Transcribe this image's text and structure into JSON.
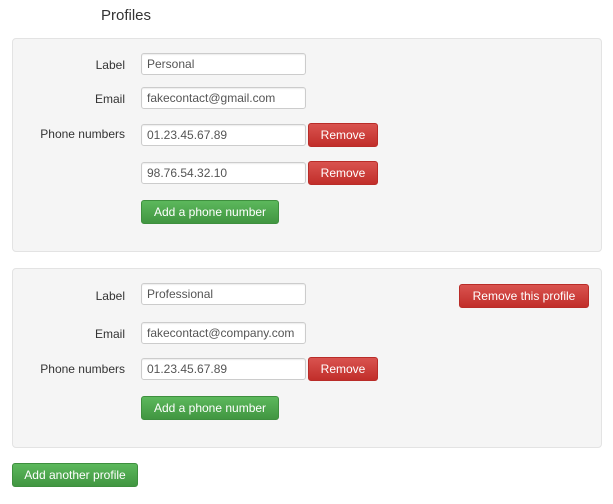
{
  "page": {
    "title": "Profiles"
  },
  "labels": {
    "label": "Label",
    "email": "Email",
    "phones": "Phone numbers"
  },
  "buttons": {
    "remove": "Remove",
    "add_phone": "Add a phone number",
    "remove_profile": "Remove this profile",
    "add_profile": "Add another profile"
  },
  "profiles": [
    {
      "label": "Personal",
      "email": "fakecontact@gmail.com",
      "phones": [
        "01.23.45.67.89",
        "98.76.54.32.10"
      ]
    },
    {
      "label": "Professional",
      "email": "fakecontact@company.com",
      "phones": [
        "01.23.45.67.89"
      ]
    }
  ],
  "colors": {
    "danger": "#d9534f",
    "success": "#5cb85c",
    "well": "#f5f5f5"
  }
}
